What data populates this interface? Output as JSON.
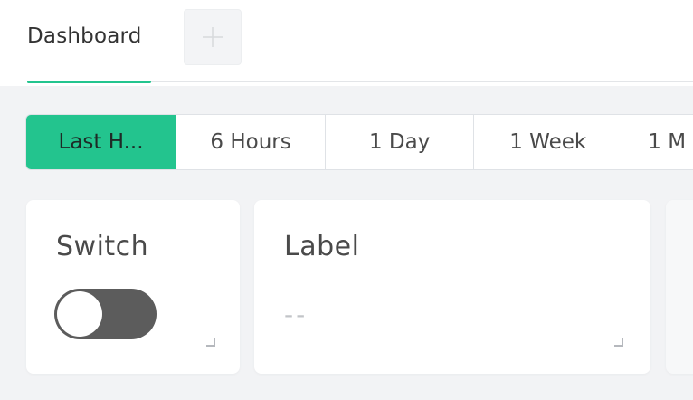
{
  "tabs": {
    "active_label": "Dashboard",
    "add_icon": "plus-icon"
  },
  "time_ranges": {
    "items": [
      {
        "label": "Last H..."
      },
      {
        "label": "6 Hours"
      },
      {
        "label": "1 Day"
      },
      {
        "label": "1 Week"
      },
      {
        "label": "1 M"
      }
    ],
    "active_index": 0
  },
  "widgets": {
    "switch": {
      "title": "Switch",
      "state": "off"
    },
    "label": {
      "title": "Label",
      "value": "--"
    }
  },
  "colors": {
    "accent": "#23c48e",
    "toggle_off": "#5c5c5c",
    "background": "#f2f3f5"
  }
}
